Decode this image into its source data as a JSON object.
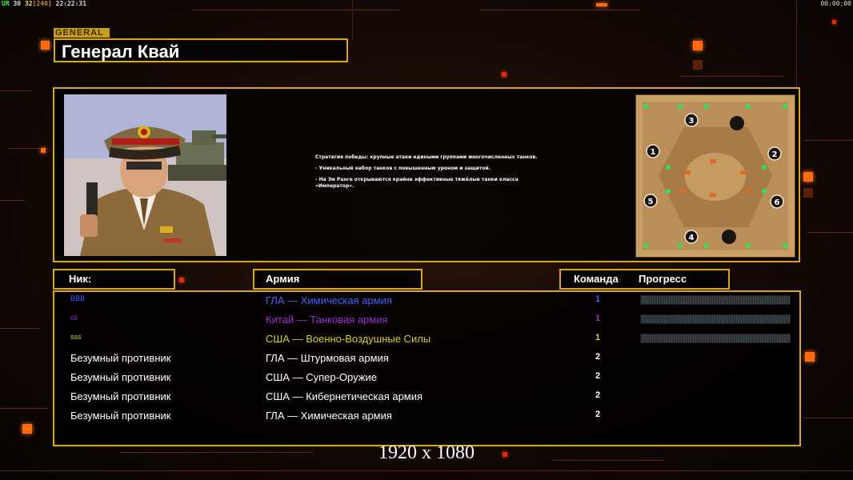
{
  "hud": {
    "tag": "UR",
    "fps": "30",
    "fps2": "32",
    "bracket": "[240]",
    "clock": "22:22:31",
    "timer": "00:00:00"
  },
  "general": {
    "label": "GENERAL",
    "name": "Генерал Квай",
    "description": [
      "Стратегия победы: крупные атаки едиными группами многочисленных танков.",
      "- Уникальный набор танков с повышенным уроном и защитой.",
      "- На 3м Ранге открываются крайне эффективные тяжёлые танки класса «Император»."
    ]
  },
  "map": {
    "markers": [
      "3",
      "1",
      "2",
      "5",
      "6",
      "4"
    ]
  },
  "headers": {
    "nick": "Ник:",
    "army": "Армия",
    "team": "Команда",
    "progress": "Прогресс"
  },
  "players": [
    {
      "nick": "BBB",
      "army": "ГЛА — Химическая армия",
      "team": "1",
      "color": "#3f63ff",
      "progress": 0
    },
    {
      "nick": "oli",
      "army": "Китай — Танковая армия",
      "team": "1",
      "color": "#9b2cd8",
      "progress": 0
    },
    {
      "nick": "sss",
      "army": "США — Военно-Воздушные Силы",
      "team": "1",
      "color": "#d2d21c",
      "progress": 0
    },
    {
      "nick": "Безумный противник",
      "army": "ГЛА — Штурмовая армия",
      "team": "2",
      "color": "#ffffff"
    },
    {
      "nick": "Безумный противник",
      "army": "США — Супер-Оружие",
      "team": "2",
      "color": "#ffffff"
    },
    {
      "nick": "Безумный противник",
      "army": "США — Кибернетическая армия",
      "team": "2",
      "color": "#ffffff"
    },
    {
      "nick": "Безумный противник",
      "army": "ГЛА — Химическая армия",
      "team": "2",
      "color": "#ffffff"
    }
  ],
  "resolution": "1920 x 1080",
  "colors": {
    "accent": "#d9a61e",
    "orange": "#ff6a10"
  }
}
